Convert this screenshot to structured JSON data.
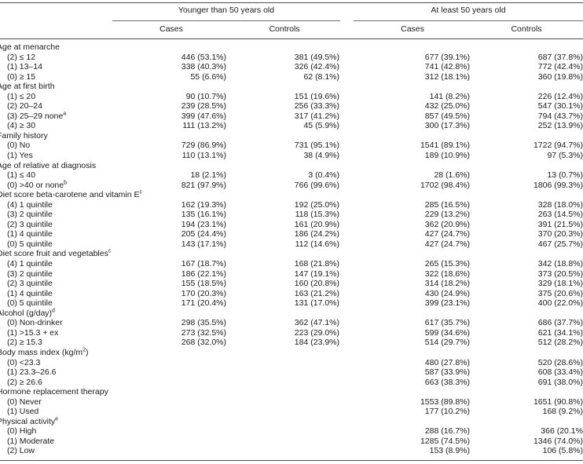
{
  "table": {
    "column_groups": [
      {
        "label": "Younger than 50 years old"
      },
      {
        "label": "At least 50 years old"
      }
    ],
    "columns": [
      {
        "label": "Cases"
      },
      {
        "label": "Controls"
      },
      {
        "label": "Cases"
      },
      {
        "label": "Controls"
      }
    ],
    "rows": [
      {
        "type": "section",
        "label": "Age at menarche",
        "values": [
          "",
          "",
          "",
          ""
        ]
      },
      {
        "type": "item",
        "label": "(2)  ≤ 12",
        "values": [
          "446 (53.1%)",
          "381 (49.5%)",
          "677 (39.1%)",
          "687 (37.8%)"
        ]
      },
      {
        "type": "item",
        "label": "(1) 13–14",
        "values": [
          "338 (40.3%)",
          "326 (42.4%)",
          "741 (42.8%)",
          "772 (42.4%)"
        ]
      },
      {
        "type": "item",
        "label": "(0)  ≥ 15",
        "values": [
          "55 (6.6%)",
          "62 (8.1%)",
          "312 (18.1%)",
          "360 (19.8%)"
        ]
      },
      {
        "type": "section",
        "label": "Age at first birth",
        "values": [
          "",
          "",
          "",
          ""
        ]
      },
      {
        "type": "item",
        "label": "(1)  ≤ 20",
        "values": [
          "90 (10.7%)",
          "151 (19.6%)",
          "141 (8.2%)",
          "226 (12.4%)"
        ]
      },
      {
        "type": "item",
        "label": "(2) 20–24",
        "values": [
          "239 (28.5%)",
          "256 (33.3%)",
          "432 (25.0%)",
          "547 (30.1%)"
        ]
      },
      {
        "type": "item",
        "label": "(3) 25–29 none",
        "sup": "a",
        "values": [
          "399 (47.6%)",
          "317 (41.2%)",
          "857 (49.5%)",
          "794 (43.7%)"
        ]
      },
      {
        "type": "item",
        "label": "(4)  ≥ 30",
        "values": [
          "111 (13.2%)",
          "45 (5.9%)",
          "300 (17.3%)",
          "252 (13.9%)"
        ]
      },
      {
        "type": "section",
        "label": "Family history",
        "values": [
          "",
          "",
          "",
          ""
        ]
      },
      {
        "type": "item",
        "label": "(0) No",
        "values": [
          "729 (86.9%)",
          "731 (95.1%)",
          "1541 (89.1%)",
          "1722 (94.7%)"
        ]
      },
      {
        "type": "item",
        "label": "(1) Yes",
        "values": [
          "110 (13.1%)",
          "38 (4.9%)",
          "189 (10.9%)",
          "97 (5.3%)"
        ]
      },
      {
        "type": "section",
        "label": "Age of relative at diagnosis",
        "values": [
          "",
          "",
          "",
          ""
        ]
      },
      {
        "type": "item",
        "label": "(1)  ≤ 40",
        "values": [
          "18 (2.1%)",
          "3 (0.4%)",
          "28 (1.6%)",
          "13 (0.7%)"
        ]
      },
      {
        "type": "item",
        "label": "(0) >40 or none",
        "sup": "b",
        "values": [
          "821 (97.9%)",
          "766 (99.6%)",
          "1702 (98.4%)",
          "1806 (99.3%)"
        ]
      },
      {
        "type": "section",
        "label": "Diet score beta-carotene and vitamin E",
        "sup": "c",
        "values": [
          "",
          "",
          "",
          ""
        ]
      },
      {
        "type": "item",
        "label": "(4) 1 quintile",
        "values": [
          "162 (19.3%)",
          "192 (25.0%)",
          "285 (16.5%)",
          "328 (18.0%)"
        ]
      },
      {
        "type": "item",
        "label": "(3) 2 quintile",
        "values": [
          "135 (16.1%)",
          "118 (15.3%)",
          "229 (13.2%)",
          "263 (14.5%)"
        ]
      },
      {
        "type": "item",
        "label": "(2) 3 quintile",
        "values": [
          "194 (23.1%)",
          "161 (20.9%)",
          "362 (20.9%)",
          "391 (21.5%)"
        ]
      },
      {
        "type": "item",
        "label": "(1) 4 quintile",
        "values": [
          "205 (24.4%)",
          "186 (24.2%)",
          "427 (24.7%)",
          "370 (20.3%)"
        ]
      },
      {
        "type": "item",
        "label": "(0) 5 quintile",
        "values": [
          "143 (17.1%)",
          "112 (14.6%)",
          "427 (24.7%)",
          "467 (25.7%)"
        ]
      },
      {
        "type": "section",
        "label": "Diet score fruit and vegetables",
        "sup": "c",
        "values": [
          "",
          "",
          "",
          ""
        ]
      },
      {
        "type": "item",
        "label": "(4) 1 quintile",
        "values": [
          "167 (18.7%)",
          "168 (21.8%)",
          "265 (15.3%)",
          "342 (18.8%)"
        ]
      },
      {
        "type": "item",
        "label": "(3) 2 quintile",
        "values": [
          "186 (22.1%)",
          "147 (19.1%)",
          "322 (18.6%)",
          "373 (20.5%)"
        ]
      },
      {
        "type": "item",
        "label": "(2) 3 quintile",
        "values": [
          "155 (18.5%)",
          "160 (20.8%)",
          "314 (18.2%)",
          "329 (18.1%)"
        ]
      },
      {
        "type": "item",
        "label": "(1) 4 quintile",
        "values": [
          "170 (20.3%)",
          "163 (21.2%)",
          "430 (24.9%)",
          "375 (20.6%)"
        ]
      },
      {
        "type": "item",
        "label": "(0) 5 quintile",
        "values": [
          "171 (20.4%)",
          "131 (17.0%)",
          "399 (23.1%)",
          "400 (22.0%)"
        ]
      },
      {
        "type": "section",
        "label": "Alcohol (g/day)",
        "sup": "d",
        "values": [
          "",
          "",
          "",
          ""
        ]
      },
      {
        "type": "item",
        "label": "(0) Non-drinker",
        "values": [
          "298 (35.5%)",
          "362 (47.1%)",
          "617 (35.7%)",
          "686 (37.7%)"
        ]
      },
      {
        "type": "item",
        "label": "(1) >15.3 + ex",
        "values": [
          "273 (32.5%)",
          "223 (29.0%)",
          "599 (34.6%)",
          "621 (34.1%)"
        ]
      },
      {
        "type": "item",
        "label": "(2)  ≥ 15.3",
        "values": [
          "268 (32.0%)",
          "184 (23.9%)",
          "514 (29.7%)",
          "512 (28.2%)"
        ]
      },
      {
        "type": "section",
        "label": "Body mass index (kg/m",
        "sup_inline": "2",
        "label_tail": ")",
        "values": [
          "",
          "",
          "",
          ""
        ]
      },
      {
        "type": "item",
        "label": "(0) <23.3",
        "values": [
          "",
          "",
          "480 (27.8%)",
          "520 (28.6%)"
        ]
      },
      {
        "type": "item",
        "label": "(1) 23.3–26.6",
        "values": [
          "",
          "",
          "587 (33.9%)",
          "608 (33.4%)"
        ]
      },
      {
        "type": "item",
        "label": "(2)  ≥ 26.6",
        "values": [
          "",
          "",
          "663 (38.3%)",
          "691 (38.0%)"
        ]
      },
      {
        "type": "section",
        "label": "Hormone replacement therapy",
        "values": [
          "",
          "",
          "",
          ""
        ]
      },
      {
        "type": "item",
        "label": "(0) Never",
        "values": [
          "",
          "",
          "1553 (89.8%)",
          "1651 (90.8%)"
        ]
      },
      {
        "type": "item",
        "label": "(1) Used",
        "values": [
          "",
          "",
          "177 (10.2%)",
          "168 (9.2%)"
        ]
      },
      {
        "type": "section",
        "label": "Physical activity",
        "sup": "e",
        "values": [
          "",
          "",
          "",
          ""
        ]
      },
      {
        "type": "item",
        "label": "(0) High",
        "values": [
          "",
          "",
          "288 (16.7%)",
          "366 (20.1%"
        ]
      },
      {
        "type": "item",
        "label": "(1) Moderate",
        "values": [
          "",
          "",
          "1285 (74.5%)",
          "1346 (74.0%)"
        ]
      },
      {
        "type": "item",
        "label": "(2) Low",
        "values": [
          "",
          "",
          "153 (8.9%)",
          "106 (5.8%)"
        ]
      }
    ]
  }
}
